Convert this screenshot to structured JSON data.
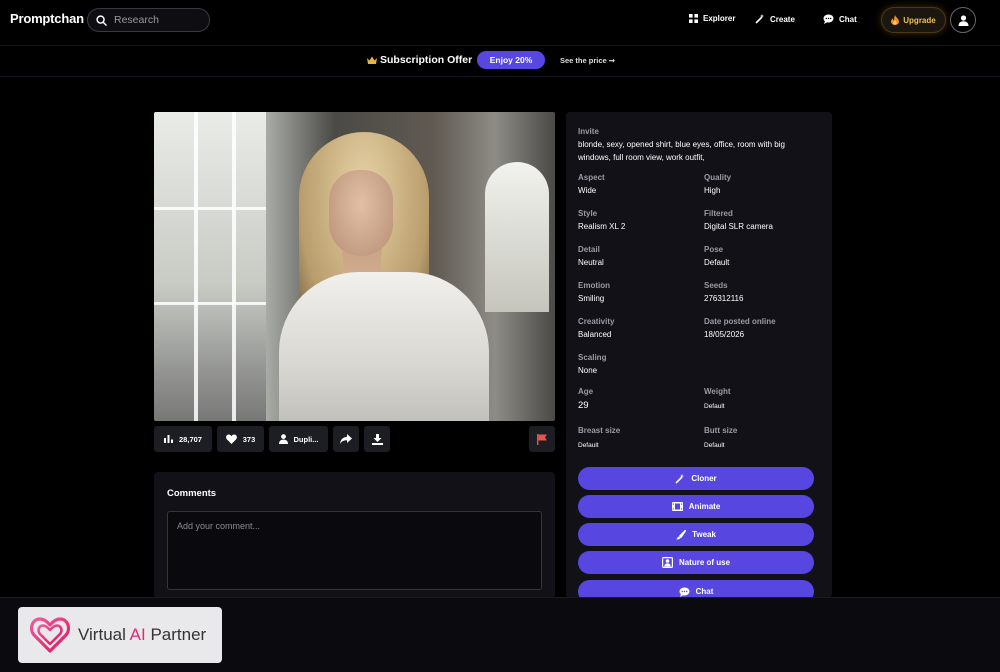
{
  "nav": {
    "logo": "Promptchan",
    "search_placeholder": "Research",
    "items": [
      {
        "label": "Explorer",
        "icon": "grid-icon"
      },
      {
        "label": "Create",
        "icon": "magic-wand-icon"
      },
      {
        "label": "Chat",
        "icon": "chat-bubble-icon"
      }
    ],
    "upgrade_label": "Upgrade",
    "upgrade_icon": "fire-icon",
    "profile_icon": "user-icon"
  },
  "subscription": {
    "icon": "crown-icon",
    "title": "Subscription Offer",
    "pill": "Enjoy 20%",
    "link": "See the price ➞"
  },
  "image": {
    "alt": "Blonde woman in open white shirt in office with big windows"
  },
  "actions": {
    "views": "28,707",
    "likes": "373",
    "duplicate": "Dupli...",
    "icons": [
      "bar-chart-icon",
      "heart-icon",
      "user-icon",
      "share-icon",
      "download-icon",
      "flag-icon"
    ]
  },
  "comments": {
    "title": "Comments",
    "placeholder": "Add your comment..."
  },
  "details": {
    "prompt_label": "Invite",
    "prompt": "blonde, sexy, opened shirt, blue eyes, office, room with big windows, full room view, work outfit,",
    "aspect_label": "Aspect",
    "aspect": "Wide",
    "quality_label": "Quality",
    "quality": "High",
    "style_label": "Style",
    "style": "Realism XL 2",
    "filtered_label": "Filtered",
    "filtered": "Digital SLR camera",
    "detail_label": "Detail",
    "detail": "Neutral",
    "pose_label": "Pose",
    "pose": "Default",
    "emotion_label": "Emotion",
    "emotion": "Smiling",
    "seeds_label": "Seeds",
    "seeds": "276312116",
    "creativity_label": "Creativity",
    "creativity": "Balanced",
    "date_label": "Date posted online",
    "date": "18/05/2026",
    "scaling_label": "Scaling",
    "scaling": "None",
    "age_label": "Age",
    "age": "29",
    "weight_label": "Weight",
    "weight": "Default",
    "breast_label": "Breast size",
    "breast": "Default",
    "butt_label": "Butt size",
    "butt": "Default"
  },
  "panel_buttons": [
    {
      "label": "Cloner",
      "icon": "magic-wand-icon"
    },
    {
      "label": "Animate",
      "icon": "film-icon"
    },
    {
      "label": "Tweak",
      "icon": "brush-icon"
    },
    {
      "label": "Nature of use",
      "icon": "person-frame-icon"
    },
    {
      "label": "Chat",
      "icon": "chat-bubble-icon"
    }
  ],
  "footer_badge": {
    "text_before": "Virtual ",
    "text_accent": "AI",
    "text_after": " Partner",
    "icon": "heart-logo-icon"
  },
  "colors": {
    "accent": "#5746e0",
    "upgrade": "#f0c24b",
    "flag": "#e5534b",
    "badge_pink": "#e0297a"
  }
}
